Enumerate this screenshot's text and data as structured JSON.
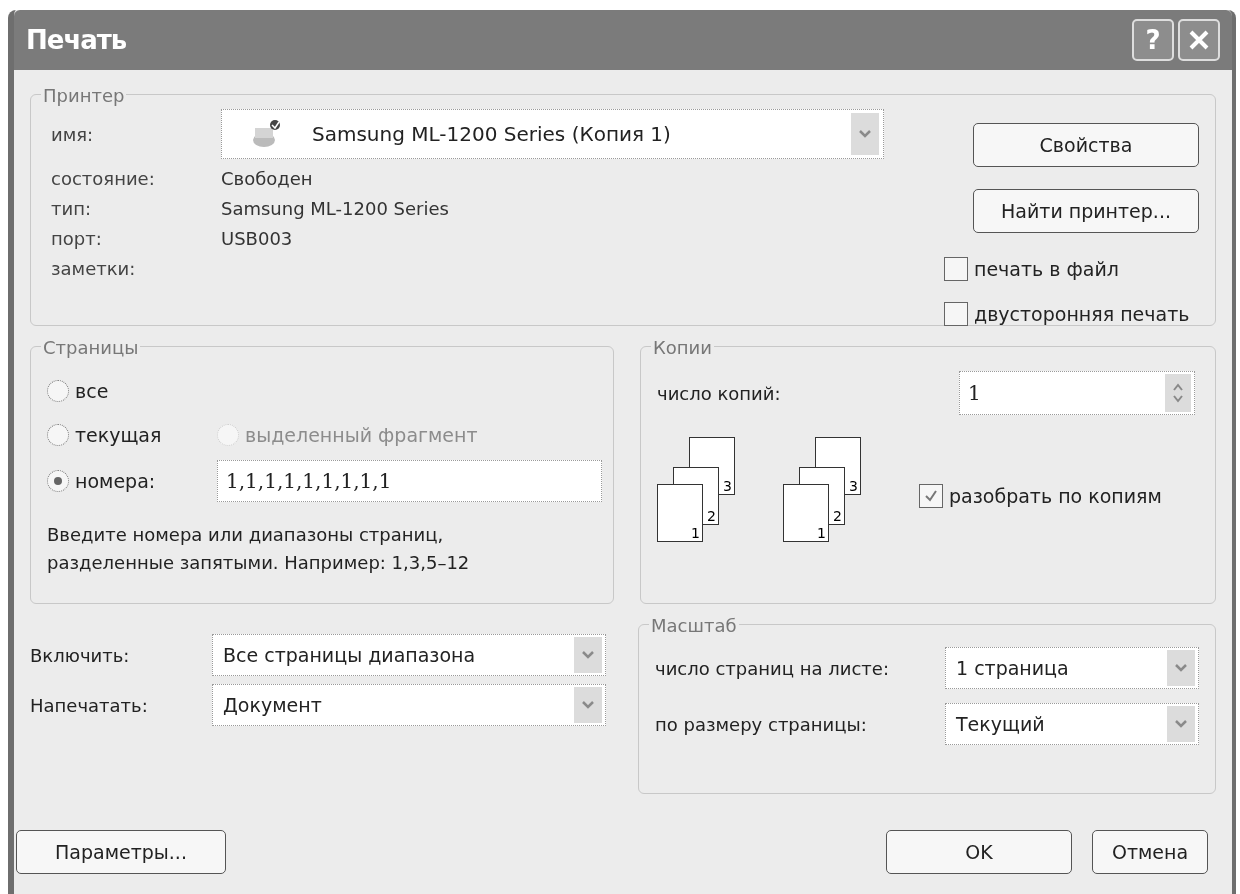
{
  "window": {
    "title": "Печать",
    "help_button": "?"
  },
  "printer": {
    "group_label": "Принтер",
    "fields": [
      {
        "kind": "combo",
        "label": "имя:",
        "value": "Samsung ML-1200 Series (Копия 1)"
      },
      {
        "kind": "text",
        "label": "состояние:",
        "value": "Свободен"
      },
      {
        "kind": "text",
        "label": "тип:",
        "value": "Samsung ML-1200 Series"
      },
      {
        "kind": "text",
        "label": "порт:",
        "value": "USB003"
      },
      {
        "kind": "text",
        "label": "заметки:"
      }
    ],
    "buttons": [
      "Свойства",
      "Найти принтер..."
    ],
    "options": [
      {
        "label": "печать в файл",
        "checked": false
      },
      {
        "label": "двусторонняя печать",
        "checked": false
      }
    ]
  },
  "pages": {
    "group_label": "Страницы",
    "options": [
      {
        "label": "все",
        "selected": false,
        "disabled": false
      },
      {
        "label": "текущая",
        "selected": false,
        "disabled": false
      },
      {
        "label": "выделенный фрагмент",
        "selected": false,
        "disabled": true
      },
      {
        "label": "номера:",
        "selected": true,
        "disabled": false
      }
    ],
    "range_value": "1,1,1,1,1,1,1,1,1",
    "hint": "Введите номера или диапазоны страниц,\nразделенные запятыми. Например: 1,3,5–12"
  },
  "copies": {
    "group_label": "Копии",
    "count_label": "число копий:",
    "count_value": "1",
    "drawings": [
      {
        "pages": [
          "1",
          "2",
          "3"
        ]
      },
      {
        "pages": [
          "1",
          "2",
          "3"
        ]
      }
    ],
    "collate": {
      "label": "разобрать по копиям",
      "checked": true
    }
  },
  "print_rows": [
    {
      "label": "Включить:",
      "value": "Все страницы диапазона"
    },
    {
      "label": "Напечатать:",
      "value": "Документ"
    }
  ],
  "scale": {
    "group_label": "Масштаб",
    "rows": [
      {
        "label": "число страниц на листе:",
        "value": "1 страница"
      },
      {
        "label": "по размеру страницы:",
        "value": "Текущий"
      }
    ]
  },
  "footer": {
    "options_button": "Параметры...",
    "ok_button": "OK",
    "cancel_button": "Отмена"
  }
}
